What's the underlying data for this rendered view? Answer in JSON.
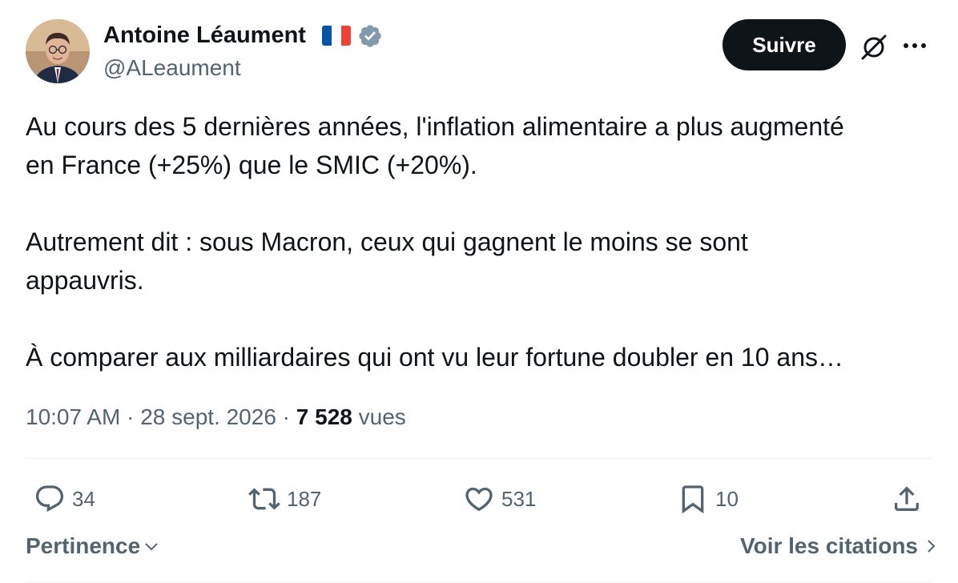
{
  "author": {
    "name": "Antoine Léaument",
    "handle": "@ALeaument"
  },
  "header": {
    "follow_label": "Suivre"
  },
  "tweet": {
    "paragraphs": [
      [
        "Au cours des 5 dernières années, l'inflation alimentaire a plus augmenté",
        "en France (+25%) que le SMIC (+20%)."
      ],
      [
        "Autrement dit : sous Macron, ceux qui gagnent le moins se sont",
        "appauvris."
      ],
      [
        "À comparer aux milliardaires qui ont vu leur fortune doubler en 10 ans…"
      ]
    ]
  },
  "meta": {
    "time": "10:07 AM",
    "sep1": " · ",
    "date": "28 sept. 2026",
    "sep2": " · ",
    "views_count": "7 528",
    "views_label": "vues"
  },
  "actions": {
    "replies": "34",
    "reposts": "187",
    "likes": "531",
    "bookmarks": "10"
  },
  "footer": {
    "sort_label": "Pertinence",
    "quotes_label": "Voir les citations"
  },
  "colors": {
    "text": "#0f1419",
    "secondary": "#536471",
    "verified": "#829aab",
    "divider": "#eff3f4"
  },
  "icons": {
    "verified": "verified-badge-icon",
    "flag": "french-flag-icon",
    "grok": "grok-icon",
    "more": "more-options-icon",
    "reply": "reply-icon",
    "repost": "repost-icon",
    "like": "heart-icon",
    "bookmark": "bookmark-icon",
    "share": "share-icon",
    "sort": "chevron-down-icon",
    "quotes": "chevron-right-icon"
  }
}
